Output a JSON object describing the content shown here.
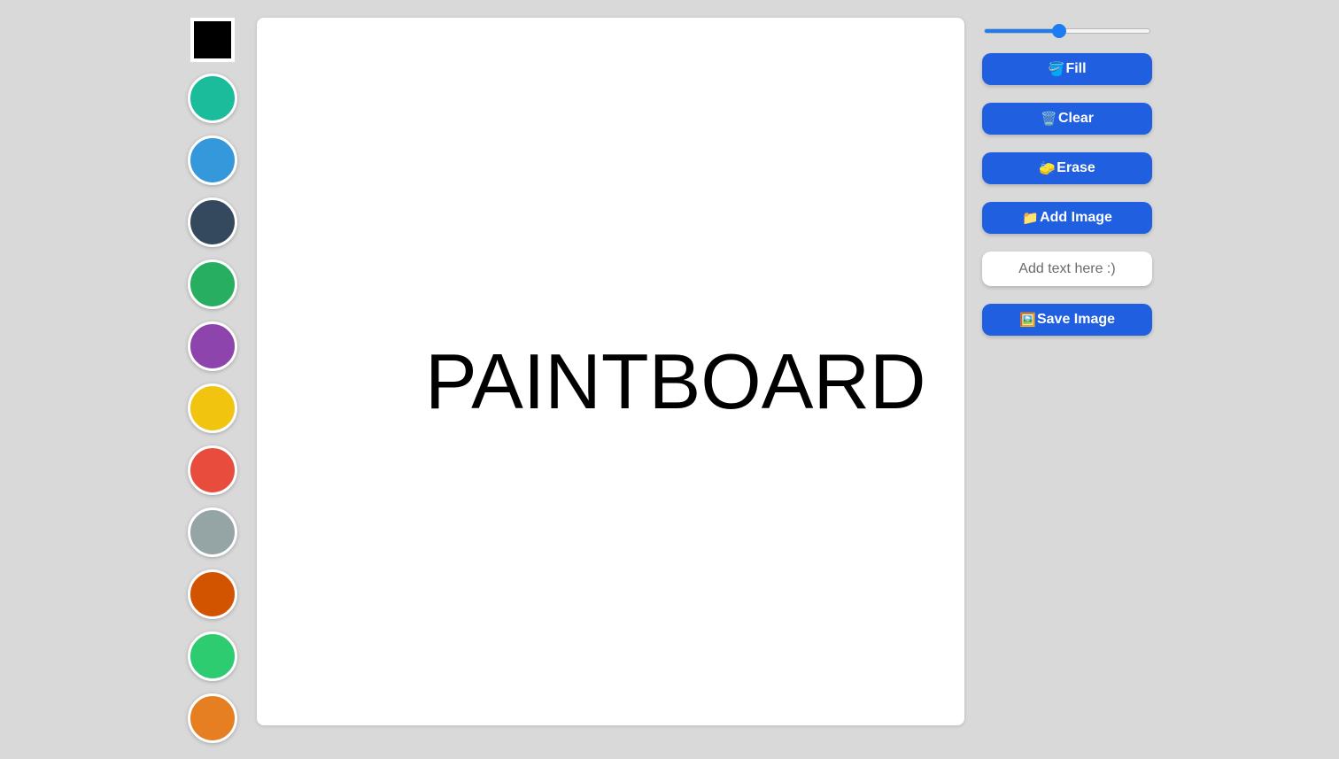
{
  "palette": {
    "current_color": "#000000",
    "swatches": [
      {
        "name": "turquoise",
        "color": "#1abc9c"
      },
      {
        "name": "blue",
        "color": "#3498db"
      },
      {
        "name": "dark-blue",
        "color": "#34495e"
      },
      {
        "name": "green",
        "color": "#27ae60"
      },
      {
        "name": "purple",
        "color": "#8e44ad"
      },
      {
        "name": "yellow",
        "color": "#f1c40f"
      },
      {
        "name": "red",
        "color": "#e74c3c"
      },
      {
        "name": "gray",
        "color": "#95a5a6"
      },
      {
        "name": "dark-orange",
        "color": "#d35400"
      },
      {
        "name": "light-green",
        "color": "#2ecc71"
      },
      {
        "name": "orange",
        "color": "#e67e22"
      }
    ]
  },
  "canvas": {
    "text": "PAINTBOARD",
    "background": "#ffffff"
  },
  "controls": {
    "brush_size": {
      "value": 45,
      "min": 0,
      "max": 100,
      "accent": "#1d7cf2"
    },
    "fill": {
      "icon": "paint-bucket-icon",
      "glyph": "🪣",
      "label": "Fill"
    },
    "clear": {
      "icon": "trash-icon",
      "glyph": "🗑️",
      "label": "Clear"
    },
    "erase": {
      "icon": "eraser-icon",
      "glyph": "🧽",
      "label": "Erase"
    },
    "add_image": {
      "icon": "folder-icon",
      "glyph": "📁",
      "label": "Add Image"
    },
    "text_input": {
      "placeholder": "Add text here :)",
      "value": ""
    },
    "save_image": {
      "icon": "picture-icon",
      "glyph": "🖼️",
      "label": "Save Image"
    },
    "button_color": "#1f5fe0"
  }
}
